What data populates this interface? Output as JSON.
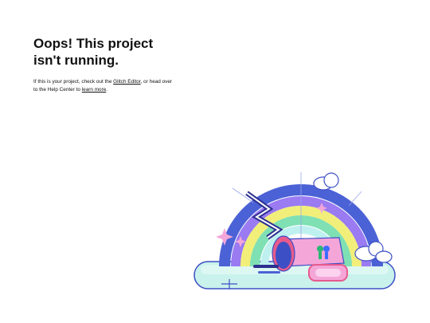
{
  "heading": {
    "line1": "Oops! This project",
    "line2": "isn't running."
  },
  "message": {
    "text_before_link1": "If this is your project, check out the ",
    "link1_label": "Glitch Editor",
    "text_between_links": ", or head over to the Help Center to ",
    "link2_label": "learn more",
    "text_after_link2": "."
  },
  "colors": {
    "background": "#ffffff",
    "text": "#111111",
    "rainbow_blue": "#4b62d6",
    "rainbow_purple": "#9a7bf2",
    "rainbow_yellow": "#f1ef7a",
    "rainbow_green": "#7fe0b3",
    "rainbow_cyan": "#bff0f0",
    "pink": "#f4a6d9",
    "water": "#c9f2ec"
  },
  "icons": {
    "illustration": "rainbow-broken-mug-illustration"
  }
}
